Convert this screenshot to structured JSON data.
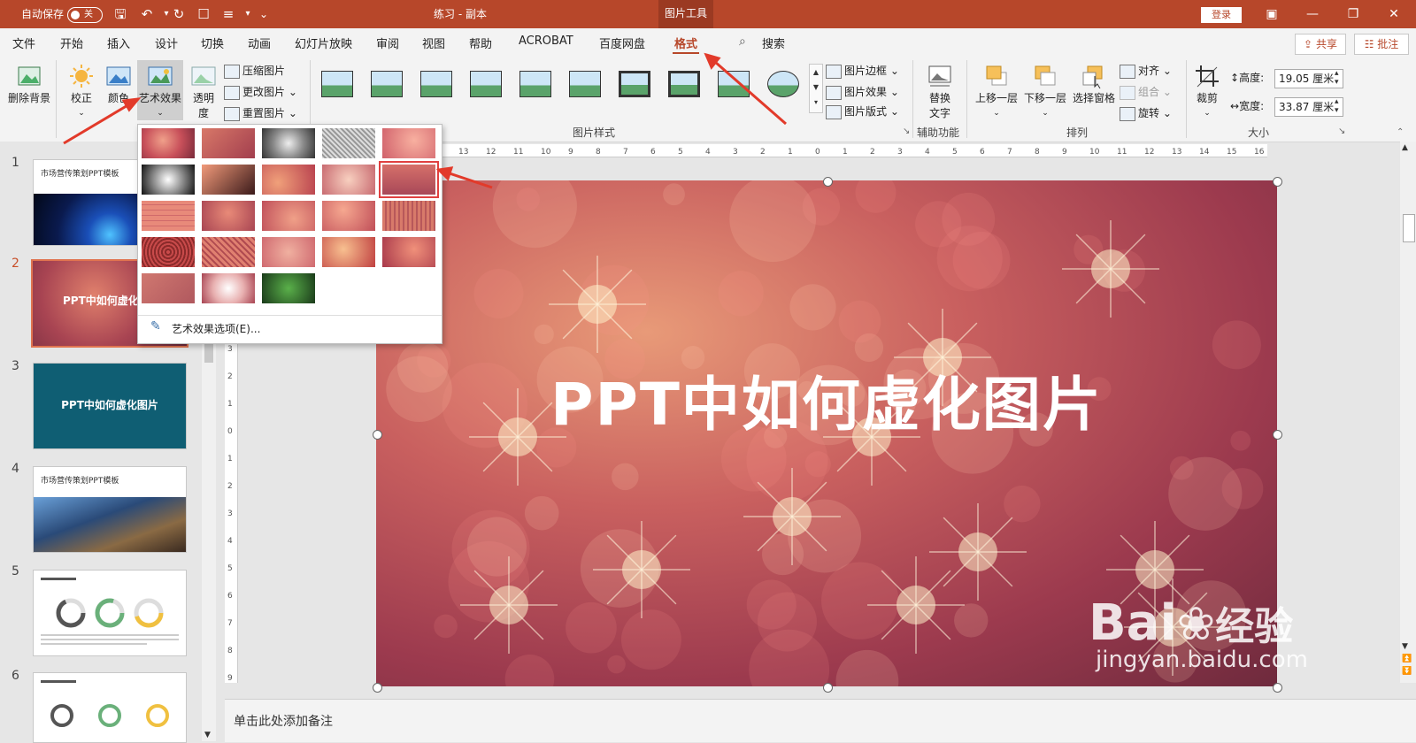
{
  "titlebar": {
    "autosave_label": "自动保存",
    "autosave_state": "关",
    "doc_title": "练习 - 副本",
    "context_tab": "图片工具",
    "login_label": "登录"
  },
  "tabs": [
    "文件",
    "开始",
    "插入",
    "设计",
    "切换",
    "动画",
    "幻灯片放映",
    "审阅",
    "视图",
    "帮助",
    "ACROBAT",
    "百度网盘",
    "格式"
  ],
  "active_tab": "格式",
  "search_label": "搜索",
  "share_label": "共享",
  "comment_label": "批注",
  "ribbon": {
    "remove_bg": "删除背景",
    "correct": "校正",
    "color": "颜色",
    "artistic": "艺术效果",
    "transparency_1": "透明",
    "transparency_2": "度",
    "compress": "压缩图片",
    "change": "更改图片",
    "reset": "重置图片",
    "styles_group": "图片样式",
    "border": "图片边框",
    "effects": "图片效果",
    "layout": "图片版式",
    "alt_text_1": "替换",
    "alt_text_2": "文字",
    "accessibility_group": "辅助功能",
    "bring_forward": "上移一层",
    "send_backward": "下移一层",
    "selection_pane": "选择窗格",
    "align": "对齐",
    "group": "组合",
    "rotate": "旋转",
    "arrange_group": "排列",
    "crop": "裁剪",
    "height_label": "高度:",
    "height_value": "19.05 厘米",
    "width_label": "宽度:",
    "width_value": "33.87 厘米",
    "size_group": "大小"
  },
  "dropdown": {
    "options_label": "艺术效果选项(E)..."
  },
  "slides": [
    {
      "num": "1",
      "title": "市场营传策划PPT模板"
    },
    {
      "num": "2",
      "title": "PPT中如何虚化"
    },
    {
      "num": "3",
      "title": "PPT中如何虚化图片"
    },
    {
      "num": "4",
      "title": "市场营传策划PPT模板"
    },
    {
      "num": "5",
      "title": ""
    },
    {
      "num": "6",
      "title": ""
    }
  ],
  "slide_main_title": "PPT中如何虚化图片",
  "notes_placeholder": "单击此处添加备注",
  "watermark": {
    "brand": "Bai",
    "suffix": "经验",
    "url": "jingyan.baidu.com"
  },
  "colors": {
    "accent": "#b7472a",
    "thumb3_bg": "#0f5e73",
    "highlight": "#e04040"
  }
}
